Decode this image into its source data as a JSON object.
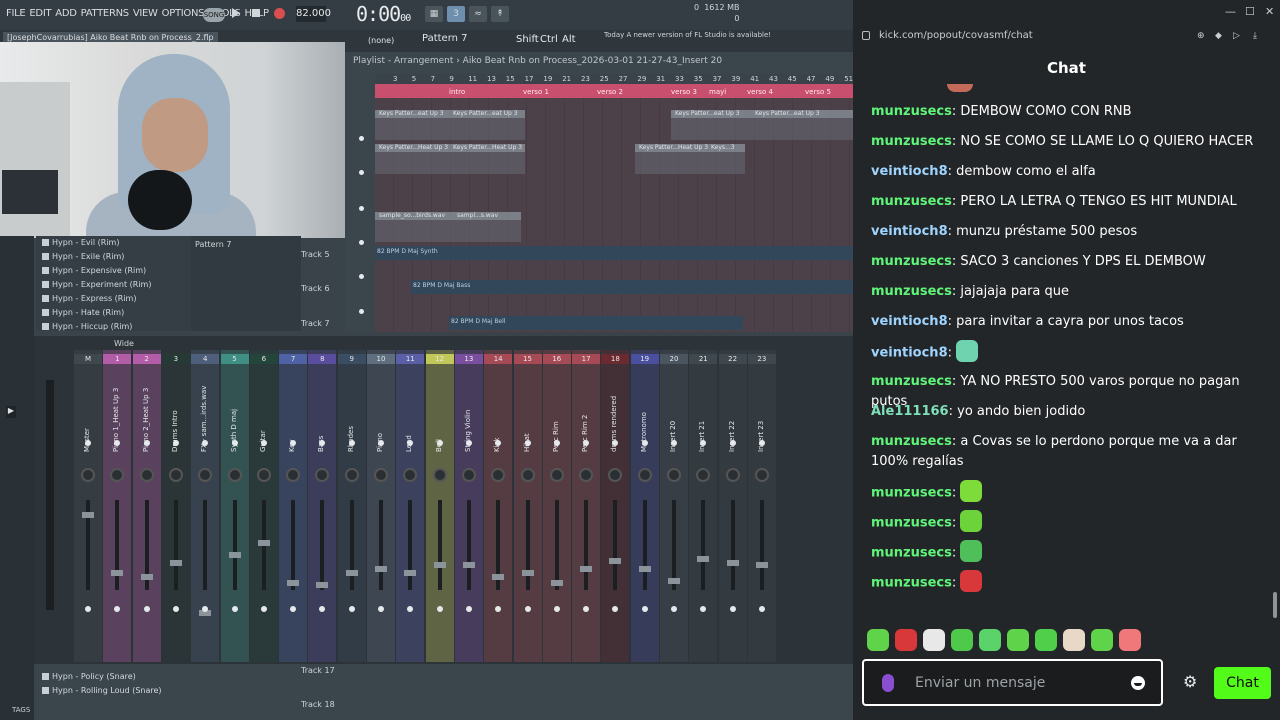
{
  "fl": {
    "menu": [
      "FILE",
      "EDIT",
      "ADD",
      "PATTERNS",
      "VIEW",
      "OPTIONS",
      "TOOLS",
      "HELP"
    ],
    "song_mode": "SONG",
    "tempo": "82.000",
    "time_main": "0:00",
    "time_sub": "00",
    "memory": "1612 MB",
    "memory_sub": "0",
    "cpu": "0",
    "project_file": "[JosephCovarrubias] Aiko Beat Rnb on Process_2.flp",
    "none_select": "(none)",
    "pattern_select": "Pattern 7",
    "shift": "Shift",
    "ctrl": "Ctrl",
    "alt": "Alt",
    "news_today": "Today",
    "news_text": "A newer version of FL Studio is available!",
    "playlist_title": "Playlist - Arrangement › Aiko Beat Rnb on Process_2026-03-01 21-27-43_Insert 20",
    "ruler_numbers": [
      "3",
      "5",
      "7",
      "9",
      "11",
      "13",
      "15",
      "17",
      "19",
      "21",
      "23",
      "25",
      "27",
      "29",
      "31",
      "33",
      "35",
      "37",
      "39",
      "41",
      "43",
      "45",
      "47",
      "49",
      "51"
    ],
    "markers": [
      "intro",
      "verso 1",
      "verso 2",
      "verso 3",
      "mayi",
      "verso 4",
      "verso 5"
    ],
    "clips": [
      {
        "label": "Keys Patter...eat Up 3"
      },
      {
        "label": "Keys Patter...eat Up 3"
      },
      {
        "label": "Keys Patter...eat Up 3"
      },
      {
        "label": "Keys Patter...eat Up 3"
      },
      {
        "label": "Keys Patter...Heat Up 3"
      },
      {
        "label": "Keys Patter...Heat Up 3"
      },
      {
        "label": "Keys Patter...Heat Up 3"
      },
      {
        "label": "Keys...3"
      },
      {
        "label": "sample_so...birds.wav"
      },
      {
        "label": "sampl...s.wav"
      }
    ],
    "tracks": [
      {
        "name": "Track 5",
        "band": "82 BPM D Maj Synth"
      },
      {
        "name": "Track 6",
        "band": "82 BPM D Maj Bass"
      },
      {
        "name": "Track 7",
        "band": "82 BPM D Maj Bell"
      }
    ],
    "browser_items": [
      "Hypn - Evil (Rim)",
      "Hypn - Exile (Rim)",
      "Hypn - Expensive (Rim)",
      "Hypn - Experiment (Rim)",
      "Hypn - Express (Rim)",
      "Hypn - Hate (Rim)",
      "Hypn - Hiccup (Rim)"
    ],
    "channel_pattern": "Pattern 7",
    "mixer_toolbar": "Wide",
    "mixer_strips": [
      {
        "num": "M",
        "name": "Master",
        "color": "#3f484f"
      },
      {
        "num": "1",
        "name": "Piano 1_Heat Up 3",
        "color": "#b35ca8"
      },
      {
        "num": "2",
        "name": "Piano 2_Heat Up 3",
        "color": "#b35ca8"
      },
      {
        "num": "3",
        "name": "Drums Intro",
        "color": "#263a35"
      },
      {
        "num": "4",
        "name": "FX - sam...irds.wav",
        "color": "#4e5f7c"
      },
      {
        "num": "5",
        "name": "Synth D maj",
        "color": "#3f8f84"
      },
      {
        "num": "6",
        "name": "Guitar",
        "color": "#24463a"
      },
      {
        "num": "7",
        "name": "Key",
        "color": "#4f62a6"
      },
      {
        "num": "8",
        "name": "Bass",
        "color": "#5b4d9e"
      },
      {
        "num": "9",
        "name": "Rhodes",
        "color": "#3a4d63"
      },
      {
        "num": "10",
        "name": "Piano",
        "color": "#5f6f80"
      },
      {
        "num": "11",
        "name": "Lead",
        "color": "#5b5fa5"
      },
      {
        "num": "12",
        "name": "Bell",
        "color": "#c2c75a"
      },
      {
        "num": "13",
        "name": "String Violin",
        "color": "#7a4fa0"
      },
      {
        "num": "14",
        "name": "Kick",
        "color": "#a64a55"
      },
      {
        "num": "15",
        "name": "Hihat",
        "color": "#a64a55"
      },
      {
        "num": "16",
        "name": "Perc Rim",
        "color": "#a64a55"
      },
      {
        "num": "17",
        "name": "Perc Rim 2",
        "color": "#a64a55"
      },
      {
        "num": "18",
        "name": "drums rendered",
        "color": "#6b2a2f"
      },
      {
        "num": "19",
        "name": "Metronomo",
        "color": "#4a4fa0"
      },
      {
        "num": "20",
        "name": "Insert 20",
        "color": "#4a5560"
      },
      {
        "num": "21",
        "name": "Insert 21",
        "color": "#3f484f"
      },
      {
        "num": "22",
        "name": "Insert 22",
        "color": "#3f484f"
      },
      {
        "num": "23",
        "name": "Insert 23",
        "color": "#3f484f"
      }
    ],
    "lower_items": [
      "Hypn - Policy (Snare)",
      "Hypn - Rolling Loud (Snare)"
    ],
    "lower_tracks": [
      "Track 17",
      "Track 18"
    ],
    "tags_label": "TAGS"
  },
  "chat": {
    "url": "kick.com/popout/covasmf/chat",
    "title": "Chat",
    "messages": [
      {
        "user": "munzusecs",
        "color": "green",
        "text": "DEMBOW COMO CON RNB"
      },
      {
        "user": "munzusecs",
        "color": "green",
        "text": "NO SE COMO SE LLAME LO Q QUIERO HACER"
      },
      {
        "user": "veintioch8",
        "color": "blue",
        "text": "dembow como el alfa"
      },
      {
        "user": "munzusecs",
        "color": "green",
        "text": "PERO LA LETRA Q TENGO ES HIT MUNDIAL"
      },
      {
        "user": "veintioch8",
        "color": "blue",
        "text": "munzu préstame 500 pesos"
      },
      {
        "user": "munzusecs",
        "color": "green",
        "text": "SACO 3 canciones Y DPS EL DEMBOW"
      },
      {
        "user": "munzusecs",
        "color": "green",
        "text": "jajajaja para que"
      },
      {
        "user": "veintioch8",
        "color": "blue",
        "text": "para invitar a cayra por unos tacos"
      },
      {
        "user": "veintioch8",
        "color": "blue",
        "text": "",
        "emote": "#6fd3b0"
      },
      {
        "user": "munzusecs",
        "color": "green",
        "text": "YA NO PRESTO 500 varos porque no pagan putos"
      },
      {
        "user": "Ale111166",
        "color": "teal",
        "text": "yo ando bien jodido"
      },
      {
        "user": "munzusecs",
        "color": "green",
        "text": "a Covas se lo perdono porque me va a dar 100% regalías"
      },
      {
        "user": "munzusecs",
        "color": "green",
        "text": "",
        "emote": "#7ddc3a"
      },
      {
        "user": "munzusecs",
        "color": "green",
        "text": "",
        "emote": "#6cd43a"
      },
      {
        "user": "munzusecs",
        "color": "green",
        "text": "",
        "emote": "#4fbf5a"
      },
      {
        "user": "munzusecs",
        "color": "green",
        "text": "",
        "emote": "#d8383a"
      }
    ],
    "emote_bar": [
      "#5fd34a",
      "#d8383a",
      "#e8e8e8",
      "#4fc94a",
      "#59d36a",
      "#5fd34a",
      "#4fcf4a",
      "#e8d8c8",
      "#5fd34a",
      "#f0787a"
    ],
    "input_placeholder": "Enviar un mensaje",
    "send_label": "Chat"
  }
}
